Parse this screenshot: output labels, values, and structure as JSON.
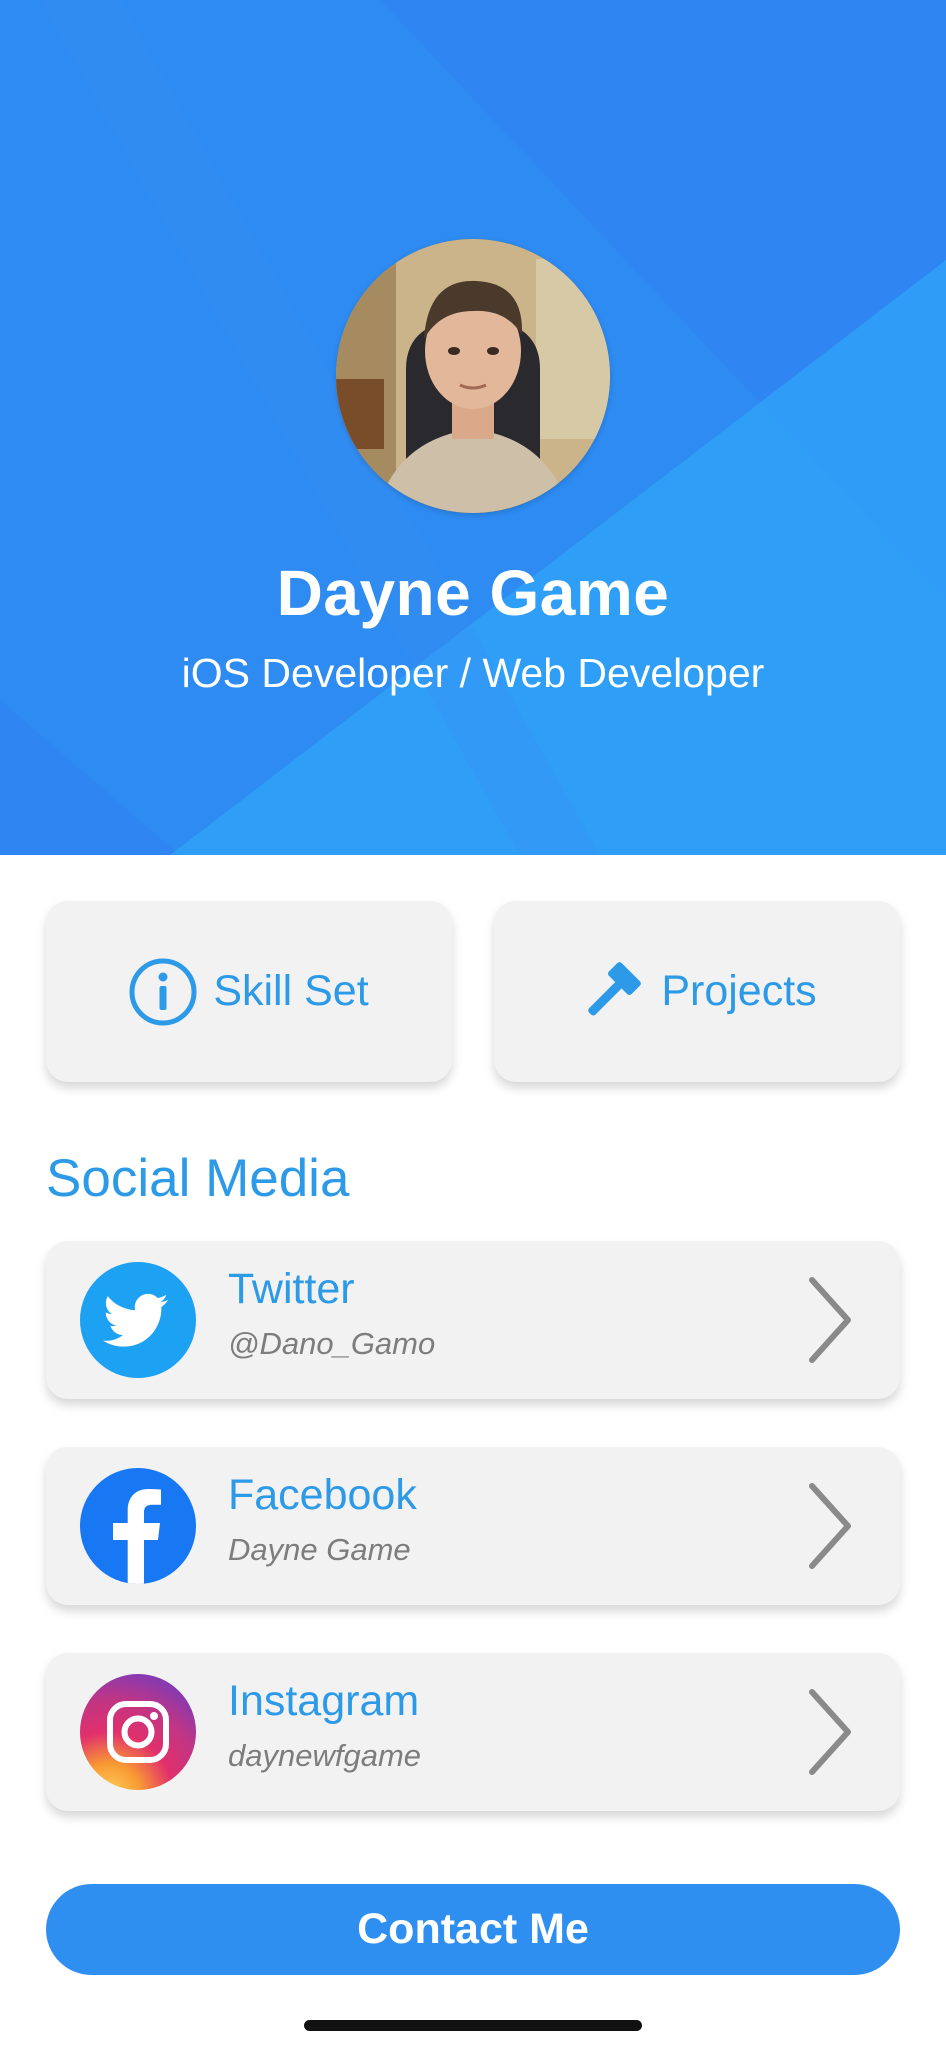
{
  "profile": {
    "name": "Dayne Game",
    "role": "iOS Developer / Web Developer"
  },
  "tiles": {
    "skills_label": "Skill Set",
    "skills_icon": "info-icon",
    "projects_label": "Projects",
    "projects_icon": "hammer-icon"
  },
  "social": {
    "title": "Social Media",
    "items": [
      {
        "platform": "Twitter",
        "handle": "@Dano_Gamo",
        "icon": "twitter-icon"
      },
      {
        "platform": "Facebook",
        "handle": "Dayne Game",
        "icon": "facebook-icon"
      },
      {
        "platform": "Instagram",
        "handle": "daynewfgame",
        "icon": "instagram-icon"
      }
    ]
  },
  "contact": {
    "label": "Contact Me"
  },
  "colors": {
    "accent": "#2d9ae8",
    "hero": "#2f86f2",
    "twitter": "#1da1f2",
    "facebook": "#1877f2"
  }
}
